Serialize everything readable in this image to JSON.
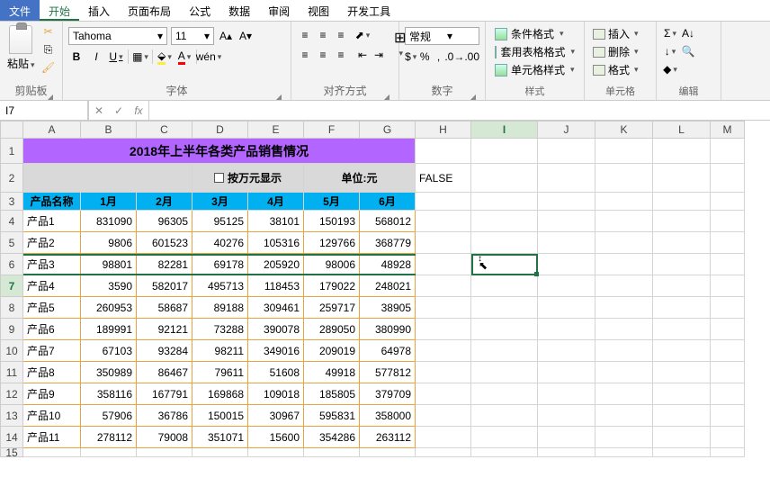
{
  "menu": {
    "file": "文件",
    "home": "开始",
    "insert": "插入",
    "layout": "页面布局",
    "formula": "公式",
    "data": "数据",
    "review": "审阅",
    "view": "视图",
    "dev": "开发工具"
  },
  "ribbon": {
    "clipboard": {
      "paste": "粘贴",
      "label": "剪贴板"
    },
    "font": {
      "name": "Tahoma",
      "size": "11",
      "label": "字体",
      "bold": "B",
      "italic": "I",
      "underline": "U",
      "wen": "wén"
    },
    "align": {
      "label": "对齐方式"
    },
    "number": {
      "format": "常规",
      "label": "数字",
      "pct": "%",
      "comma": ",",
      "currency": "$"
    },
    "styles": {
      "cond": "条件格式",
      "table": "套用表格格式",
      "cell": "单元格样式",
      "label": "样式"
    },
    "cells": {
      "insert": "插入",
      "delete": "删除",
      "format": "格式",
      "label": "单元格"
    },
    "edit": {
      "label": "编辑",
      "sigma": "Σ",
      "fill": "↓",
      "clear": "◆"
    }
  },
  "formula_bar": {
    "name_box": "I7",
    "fx": "fx"
  },
  "columns": [
    "A",
    "B",
    "C",
    "D",
    "E",
    "F",
    "G",
    "H",
    "I",
    "J",
    "K",
    "L",
    "M"
  ],
  "sheet": {
    "title": "2018年上半年各类产品销售情况",
    "checkbox_label": "按万元显示",
    "unit_label": "单位:元",
    "h2": "FALSE",
    "headers": [
      "产品名称",
      "1月",
      "2月",
      "3月",
      "4月",
      "5月",
      "6月"
    ],
    "rows": [
      {
        "name": "产品1",
        "v": [
          "831090",
          "96305",
          "95125",
          "38101",
          "150193",
          "568012"
        ]
      },
      {
        "name": "产品2",
        "v": [
          "9806",
          "601523",
          "40276",
          "105316",
          "129766",
          "368779"
        ]
      },
      {
        "name": "产品3",
        "v": [
          "98801",
          "82281",
          "69178",
          "205920",
          "98006",
          "48928"
        ]
      },
      {
        "name": "产品4",
        "v": [
          "3590",
          "582017",
          "495713",
          "118453",
          "179022",
          "248021"
        ]
      },
      {
        "name": "产品5",
        "v": [
          "260953",
          "58687",
          "89188",
          "309461",
          "259717",
          "38905"
        ]
      },
      {
        "name": "产品6",
        "v": [
          "189991",
          "92121",
          "73288",
          "390078",
          "289050",
          "380990"
        ]
      },
      {
        "name": "产品7",
        "v": [
          "67103",
          "93284",
          "98211",
          "349016",
          "209019",
          "64978"
        ]
      },
      {
        "name": "产品8",
        "v": [
          "350989",
          "86467",
          "79611",
          "51608",
          "49918",
          "577812"
        ]
      },
      {
        "name": "产品9",
        "v": [
          "358116",
          "167791",
          "169868",
          "109018",
          "185805",
          "379709"
        ]
      },
      {
        "name": "产品10",
        "v": [
          "57906",
          "36786",
          "150015",
          "30967",
          "595831",
          "358000"
        ]
      },
      {
        "name": "产品11",
        "v": [
          "278112",
          "79008",
          "351071",
          "15600",
          "354286",
          "263112"
        ]
      }
    ]
  }
}
